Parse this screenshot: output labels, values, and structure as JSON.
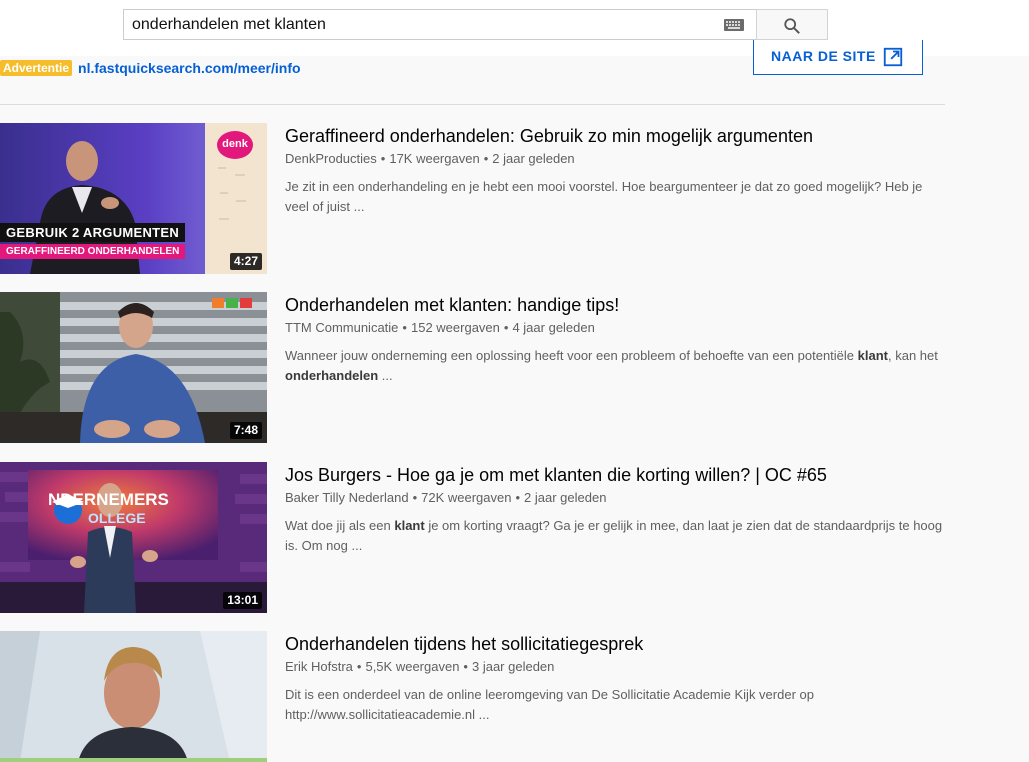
{
  "search": {
    "query": "onderhandelen met klanten"
  },
  "ad": {
    "badge": "Advertentie",
    "url": "nl.fastquicksearch.com/meer/info",
    "visit_label": "NAAR DE SITE"
  },
  "results": [
    {
      "title": "Geraffineerd onderhandelen: Gebruik zo min mogelijk argumenten",
      "channel": "DenkProducties",
      "views": "17K weergaven",
      "age": "2 jaar geleden",
      "desc_parts": [
        {
          "text": "Je zit in een onderhandeling en je hebt een mooi voorstel. Hoe beargumenteer je dat zo goed mogelijk? Heb je veel of juist ...",
          "bold": false
        }
      ],
      "duration": "4:27",
      "thumb_caption1": "GEBRUIK 2 ARGUMENTEN",
      "thumb_caption2": "GERAFFINEERD ONDERHANDELEN",
      "thumb_badge": "denk"
    },
    {
      "title": "Onderhandelen met klanten: handige tips!",
      "channel": "TTM Communicatie",
      "views": "152 weergaven",
      "age": "4 jaar geleden",
      "desc_parts": [
        {
          "text": "Wanneer jouw onderneming een oplossing heeft voor een probleem of behoefte van een potentiële ",
          "bold": false
        },
        {
          "text": "klant",
          "bold": true
        },
        {
          "text": ", kan het ",
          "bold": false
        },
        {
          "text": "onderhandelen",
          "bold": true
        },
        {
          "text": " ...",
          "bold": false
        }
      ],
      "duration": "7:48"
    },
    {
      "title": "Jos Burgers - Hoe ga je om met klanten die korting willen? | OC #65",
      "channel": "Baker Tilly Nederland",
      "views": "72K weergaven",
      "age": "2 jaar geleden",
      "desc_parts": [
        {
          "text": "Wat doe jij als een ",
          "bold": false
        },
        {
          "text": "klant",
          "bold": true
        },
        {
          "text": " je om korting vraagt? Ga je er gelijk in mee, dan laat je zien dat de standaardprijs te hoog is. Om nog ...",
          "bold": false
        }
      ],
      "duration": "13:01",
      "thumb_logo_1": "NDERNEMERS",
      "thumb_logo_2": "OLLEGE"
    },
    {
      "title": "Onderhandelen tijdens het sollicitatiegesprek",
      "channel": "Erik Hofstra",
      "views": "5,5K weergaven",
      "age": "3 jaar geleden",
      "desc_parts": [
        {
          "text": "Dit is een onderdeel van de online leeromgeving van De Sollicitatie Academie Kijk verder op http://www.sollicitatieacademie.nl ...",
          "bold": false
        }
      ],
      "duration": ""
    }
  ],
  "icons": {
    "keyboard": "keyboard-icon",
    "search": "search-icon",
    "open_external": "open-external-icon"
  },
  "colors": {
    "link_blue": "#065fd4",
    "ad_badge": "#f6bd2b",
    "meta_gray": "#606060",
    "page_bg": "#f9f9f9"
  }
}
